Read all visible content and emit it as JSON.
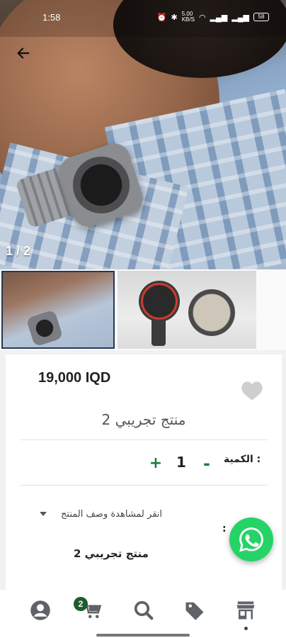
{
  "status_bar": {
    "time": "1:58",
    "network_speed": "5.00\nKB/S",
    "battery": "58"
  },
  "gallery": {
    "page_indicator": "1 / 2",
    "thumbnail_count": 2
  },
  "product": {
    "price": "19,000 IQD",
    "title": "منتج تجريبي 2",
    "quantity_label": "الكمية :",
    "quantity_value": "1",
    "minus_label": "-",
    "plus_label": "+",
    "description_toggle": "انقر لمشاهدة وصف المنتج",
    "description_colon": ":",
    "description_text": "منتج تجريبي 2"
  },
  "bottom_nav": {
    "items": [
      "profile",
      "cart",
      "search",
      "offers",
      "store"
    ],
    "cart_badge": "2",
    "active": "store"
  },
  "colors": {
    "accent_green": "#1a7f3c",
    "whatsapp": "#25d366",
    "badge": "#1f5c2d",
    "icon_gray": "#5f6368"
  }
}
